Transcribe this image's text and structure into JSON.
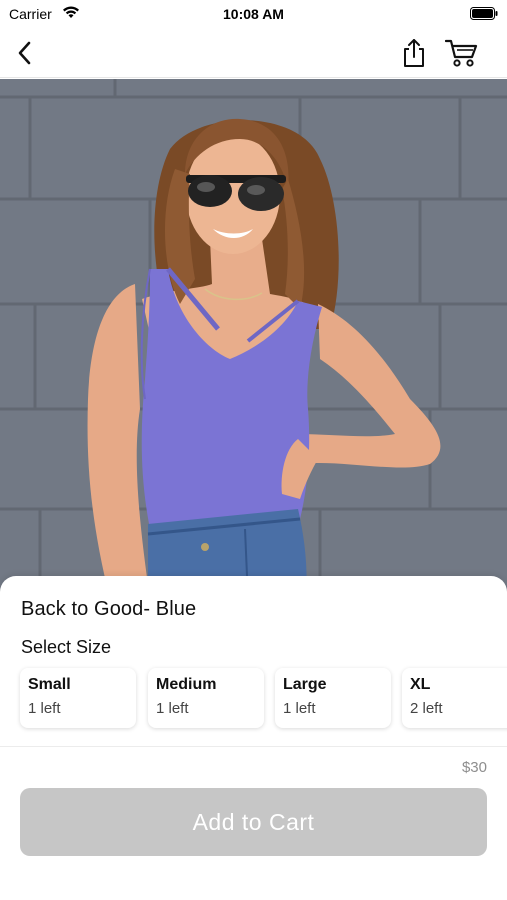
{
  "status_bar": {
    "carrier": "Carrier",
    "time": "10:08 AM"
  },
  "nav": {
    "back_icon": "chevron-left-icon",
    "share_icon": "share-icon",
    "cart_icon": "cart-icon"
  },
  "product": {
    "title": "Back to Good- Blue",
    "select_size_label": "Select Size",
    "sizes": [
      {
        "name": "Small",
        "qty": "1 left"
      },
      {
        "name": "Medium",
        "qty": "1 left"
      },
      {
        "name": "Large",
        "qty": "1 left"
      },
      {
        "name": "XL",
        "qty": "2 left"
      }
    ],
    "price": "$30",
    "add_to_cart_label": "Add to Cart",
    "add_to_cart_enabled": false
  },
  "colors": {
    "button_disabled_bg": "#c6c6c6",
    "price_text": "#8e8e8e",
    "top_color": "#7b74d4"
  }
}
